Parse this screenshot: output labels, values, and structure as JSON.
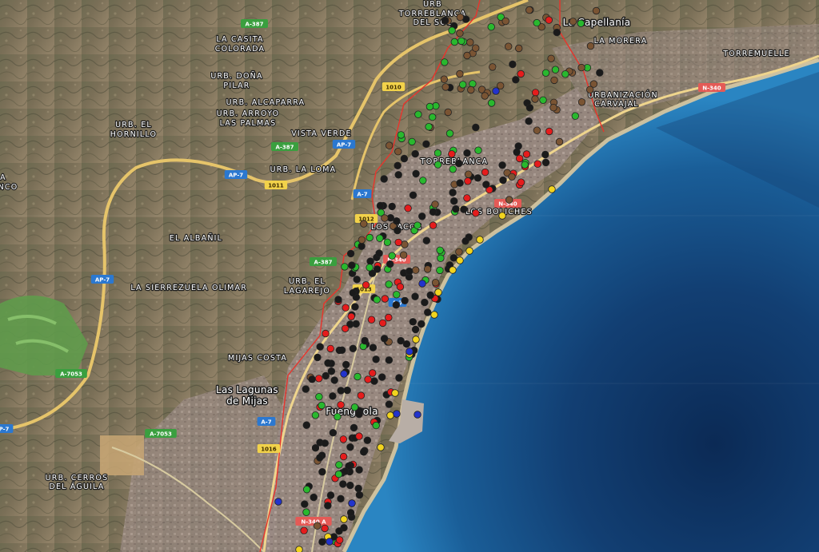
{
  "map": {
    "colors": {
      "sea_deep": "#0b2f57",
      "sea_mid": "#15568f",
      "sea_shore": "#2d86c5",
      "land_rural": "#6e6a52",
      "land_urban": "#9c8c86",
      "beach": "#d9c9a2",
      "highway": "#e7c56b",
      "boundary": "#e8342c",
      "golf": "#5c9a4a"
    },
    "legend_colors": {
      "black": "#1a1a1a",
      "green": "#29b82e",
      "red": "#e51c1c",
      "brown": "#7a5433",
      "yellow": "#f2d41f",
      "blue": "#2233cc"
    },
    "labels": [
      {
        "id": "urb-torreblanca-del-sol-1",
        "text": "URB"
      },
      {
        "id": "urb-torreblanca-del-sol-2",
        "text": "TORREBLANCA"
      },
      {
        "id": "urb-torreblanca-del-sol-3",
        "text": "DEL SOL"
      },
      {
        "id": "la-capellania",
        "text": "La Capellanía"
      },
      {
        "id": "la-morera",
        "text": "LA MORERA"
      },
      {
        "id": "torremuelle",
        "text": "TORREMUELLE"
      },
      {
        "id": "la-casita-colorada-1",
        "text": "LA CASITA"
      },
      {
        "id": "la-casita-colorada-2",
        "text": "COLORADA"
      },
      {
        "id": "urb-dona-pilar-1",
        "text": "URB. DOÑA"
      },
      {
        "id": "urb-dona-pilar-2",
        "text": "PILAR"
      },
      {
        "id": "urb-alcaparra",
        "text": "URB. ALCAPARRA"
      },
      {
        "id": "urb-arroyo-1",
        "text": "URB. ARROYO"
      },
      {
        "id": "urb-arroyo-2",
        "text": "LAS PALMAS"
      },
      {
        "id": "urb-el-hornillo-1",
        "text": "URB. EL"
      },
      {
        "id": "urb-el-hornillo-2",
        "text": "HORNILLO"
      },
      {
        "id": "vista-verde",
        "text": "VISTA VERDE"
      },
      {
        "id": "urb-la-loma",
        "text": "URB. LA LOMA"
      },
      {
        "id": "urbanizacion-carvajal-1",
        "text": "URBANIZACIÓN"
      },
      {
        "id": "urbanizacion-carvajal-2",
        "text": "CARVAJAL"
      },
      {
        "id": "torreblanca",
        "text": "TORREBLANCA"
      },
      {
        "id": "los-boliches",
        "text": "LOS BOLICHES"
      },
      {
        "id": "los-pacos",
        "text": "LOS PACOS"
      },
      {
        "id": "el-albanil",
        "text": "EL ALBAÑIL"
      },
      {
        "id": "la-sierrezuela",
        "text": "LA SIERREZUELA"
      },
      {
        "id": "olimar",
        "text": "OLIMAR"
      },
      {
        "id": "urb-el-lagarejo-1",
        "text": "URB. EL"
      },
      {
        "id": "urb-el-lagarejo-2",
        "text": "LAGAREJO"
      },
      {
        "id": "mijas-costa",
        "text": "MIJAS COSTA"
      },
      {
        "id": "las-lagunas-1",
        "text": "Las Lagunas"
      },
      {
        "id": "las-lagunas-2",
        "text": "de Mijas"
      },
      {
        "id": "fuengirola",
        "text": "Fuengirola"
      },
      {
        "id": "urb-cerros-1",
        "text": "URB. CERROS"
      },
      {
        "id": "urb-cerros-2",
        "text": "DEL ÁGUILA"
      },
      {
        "id": "edge-label-1",
        "text": "A"
      },
      {
        "id": "edge-label-2",
        "text": "NCO"
      }
    ],
    "road_shields": [
      {
        "id": "a387-top",
        "text": "A-387",
        "kind": "green"
      },
      {
        "id": "a387-mid",
        "text": "A-387",
        "kind": "green"
      },
      {
        "id": "a387-low",
        "text": "A-387",
        "kind": "green"
      },
      {
        "id": "ap7-mid",
        "text": "AP-7",
        "kind": "blue"
      },
      {
        "id": "ap7-left",
        "text": "AP-7",
        "kind": "blue"
      },
      {
        "id": "ap7-west",
        "text": "AP-7",
        "kind": "blue"
      },
      {
        "id": "ap7-edge",
        "text": "P-7",
        "kind": "blue"
      },
      {
        "id": "a7-near",
        "text": "A-7",
        "kind": "blue"
      },
      {
        "id": "a7-bottom",
        "text": "A-7",
        "kind": "blue"
      },
      {
        "id": "a7-center",
        "text": "A-7",
        "kind": "blue"
      },
      {
        "id": "r1010",
        "text": "1010",
        "kind": "yellow"
      },
      {
        "id": "r1011",
        "text": "1011",
        "kind": "yellow"
      },
      {
        "id": "r1012",
        "text": "1012",
        "kind": "yellow"
      },
      {
        "id": "r1013",
        "text": "1013",
        "kind": "yellow"
      },
      {
        "id": "r1016",
        "text": "1016",
        "kind": "yellow"
      },
      {
        "id": "n340-top",
        "text": "N-340",
        "kind": "red"
      },
      {
        "id": "n340-mid",
        "text": "N-340",
        "kind": "red"
      },
      {
        "id": "n340-center",
        "text": "N-340",
        "kind": "red"
      },
      {
        "id": "n340-bottom",
        "text": "N-340 A",
        "kind": "red"
      },
      {
        "id": "a7053-left",
        "text": "A-7053",
        "kind": "green"
      },
      {
        "id": "a7053-center",
        "text": "A-7053",
        "kind": "green"
      }
    ]
  }
}
